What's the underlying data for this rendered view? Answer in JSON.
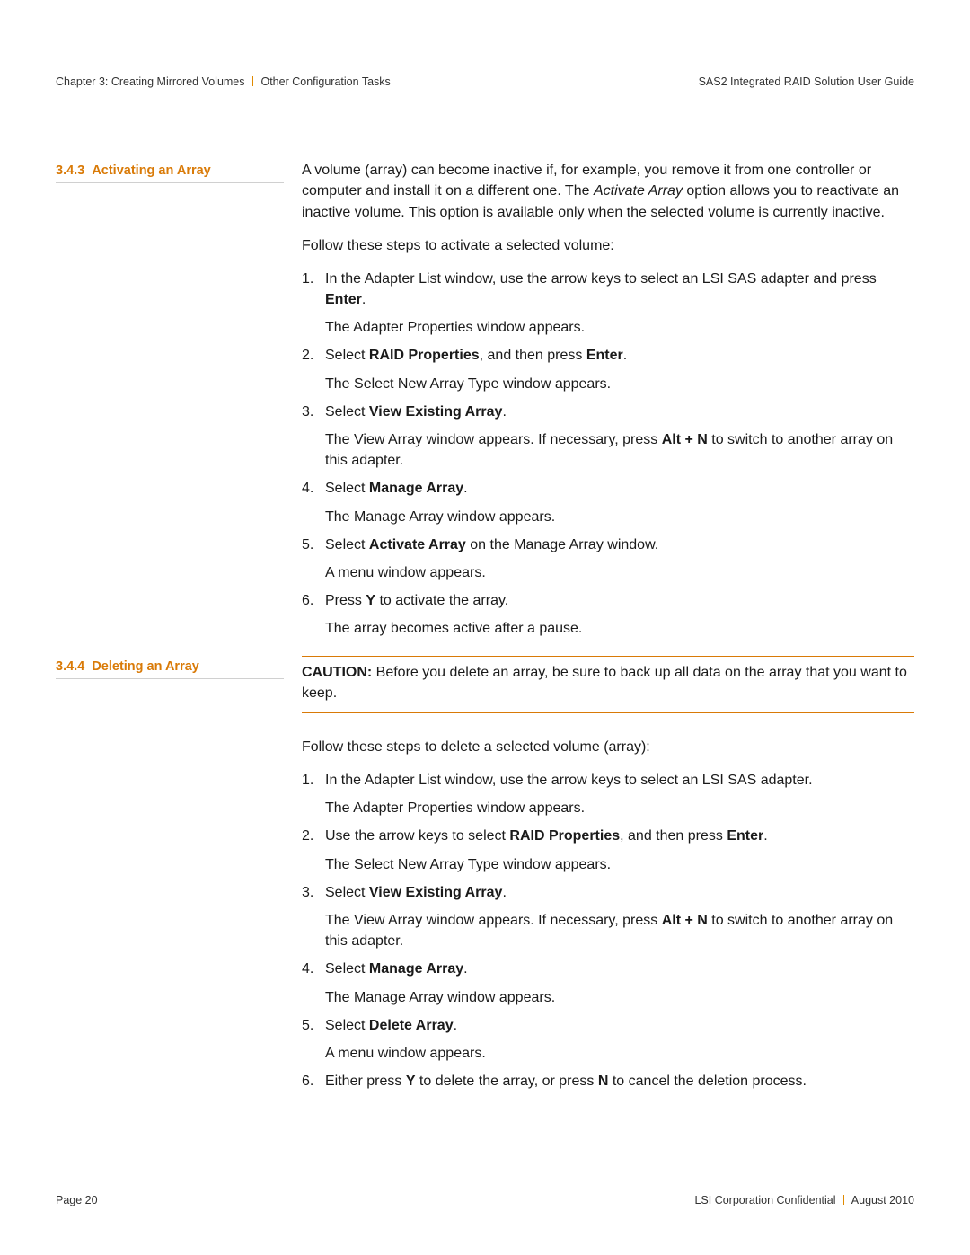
{
  "header": {
    "left_chapter": "Chapter 3: Creating Mirrored Volumes",
    "left_sub": "Other Configuration Tasks",
    "right": "SAS2 Integrated RAID Solution User Guide"
  },
  "section_a": {
    "number": "3.4.3",
    "title": "Activating an Array",
    "intro_pre": "A volume (array) can become inactive if, for example, you remove it from one controller or computer and install it on a different one. The ",
    "intro_ital": "Activate Array",
    "intro_post": " option allows you to reactivate an inactive volume. This option is available only when the selected volume is currently inactive.",
    "lead": "Follow these steps to activate a selected volume:",
    "steps": [
      {
        "pre": "In the Adapter List window, use the arrow keys to select an LSI SAS adapter and press ",
        "b1": "Enter",
        "post": ".",
        "result": "The Adapter Properties window appears."
      },
      {
        "pre": "Select ",
        "b1": "RAID Properties",
        "mid": ", and then press ",
        "b2": "Enter",
        "post": ".",
        "result": "The Select New Array Type window appears."
      },
      {
        "pre": "Select ",
        "b1": "View Existing Array",
        "post": ".",
        "result_pre": "The View Array window appears. If necessary, press ",
        "result_b": "Alt + N",
        "result_post": " to switch to another array on this adapter."
      },
      {
        "pre": "Select ",
        "b1": "Manage Array",
        "post": ".",
        "result": "The Manage Array window appears."
      },
      {
        "pre": "Select ",
        "b1": "Activate Array",
        "post": " on the Manage Array window.",
        "result": "A menu window appears."
      },
      {
        "pre": "Press ",
        "b1": "Y",
        "post": " to activate the array.",
        "result": "The array becomes active after a pause."
      }
    ]
  },
  "section_b": {
    "number": "3.4.4",
    "title": "Deleting an Array",
    "caution_label": "CAUTION:",
    "caution_text": "  Before you delete an array, be sure to back up all data on the array that you want to keep.",
    "lead": "Follow these steps to delete a selected volume (array):",
    "steps": [
      {
        "pre": "In the Adapter List window, use the arrow keys to select an LSI SAS adapter.",
        "result": "The Adapter Properties window appears."
      },
      {
        "pre": "Use the arrow keys to select ",
        "b1": "RAID Properties",
        "mid": ", and then press ",
        "b2": "Enter",
        "post": ".",
        "result": "The Select New Array Type window appears."
      },
      {
        "pre": "Select ",
        "b1": "View Existing Array",
        "post": ".",
        "result_pre": "The View Array window appears. If necessary, press ",
        "result_b": "Alt + N",
        "result_post": " to switch to another array on this adapter."
      },
      {
        "pre": "Select ",
        "b1": "Manage Array",
        "post": ".",
        "result": "The Manage Array window appears."
      },
      {
        "pre": "Select ",
        "b1": "Delete Array",
        "post": ".",
        "result": "A menu window appears."
      },
      {
        "pre": "Either press ",
        "b1": "Y",
        "mid": " to delete the array, or press ",
        "b2": "N",
        "post": " to cancel the deletion process."
      }
    ]
  },
  "footer": {
    "left": "Page 20",
    "right_a": "LSI Corporation Confidential",
    "right_b": "August 2010"
  }
}
